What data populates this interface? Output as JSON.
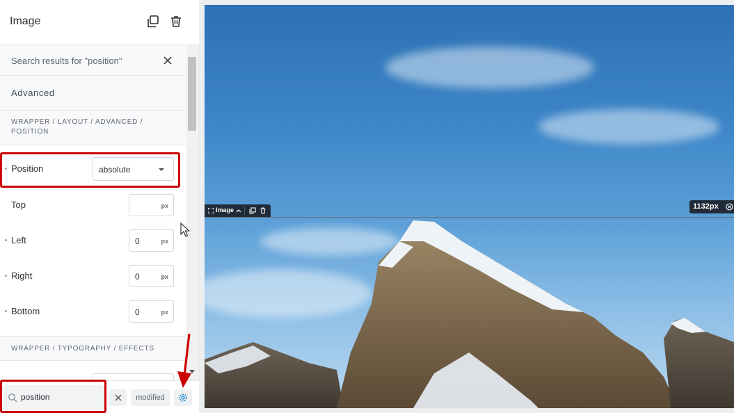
{
  "panel": {
    "title": "Image",
    "search_results_label": "Search results for \"position\"",
    "section_title": "Advanced",
    "path_1": "WRAPPER / LAYOUT / ADVANCED / POSITION",
    "path_2": "WRAPPER / TYPOGRAPHY / EFFECTS",
    "position": {
      "label": "Position",
      "value": "absolute"
    },
    "fields": [
      {
        "label": "Top",
        "value": "",
        "unit": "px"
      },
      {
        "label": "Left",
        "value": "0",
        "unit": "px"
      },
      {
        "label": "Right",
        "value": "0",
        "unit": "px"
      },
      {
        "label": "Bottom",
        "value": "0",
        "unit": "px"
      }
    ]
  },
  "footer": {
    "search_value": "position",
    "modified_label": "modified"
  },
  "canvas": {
    "element_tag": "Image",
    "width_readout": "1132px"
  },
  "colors": {
    "accent": "#1e88c8",
    "highlight": "#cc0000",
    "toolbar_dark": "#1f2b36"
  }
}
